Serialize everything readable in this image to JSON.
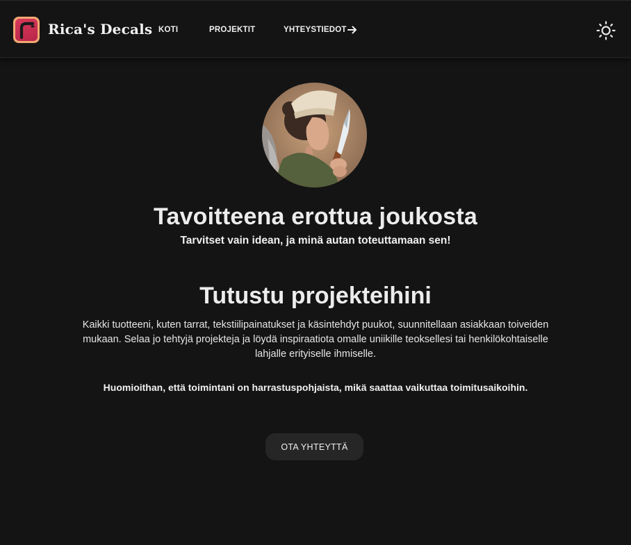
{
  "header": {
    "brand": "Rica's Decals",
    "nav": [
      {
        "label": "KOTI"
      },
      {
        "label": "PROJEKTIT"
      },
      {
        "label": "YHTEYSTIEDOT"
      }
    ],
    "contact_arrow_icon": "arrow-right-icon",
    "theme_toggle_icon": "sun-icon"
  },
  "hero": {
    "avatar_alt": "woman-with-knife-illustration",
    "title": "Tavoitteena erottua joukosta",
    "subtitle": "Tarvitset vain idean, ja minä autan toteuttamaan sen!"
  },
  "projects": {
    "title": "Tutustu projekteihini",
    "description": "Kaikki tuotteeni, kuten tarrat, tekstiilipainatukset ja käsintehdyt puukot, suunnitellaan asiakkaan toiveiden mukaan. Selaa jo tehtyjä projekteja ja löydä inspiraatiota omalle uniikille teoksellesi tai henkilökohtaiselle lahjalle erityiselle ihmiselle.",
    "note": "Huomioithan, että toimintani on harrastuspohjaista, mikä saattaa vaikuttaa toimitusaikoihin.",
    "cta": "OTA YHTEYTTÄ"
  },
  "colors": {
    "background": "#141414",
    "text": "#f0f0f0",
    "button": "#262626",
    "logo_frame": "#f2a772",
    "logo_fill": "#d83a5a"
  }
}
